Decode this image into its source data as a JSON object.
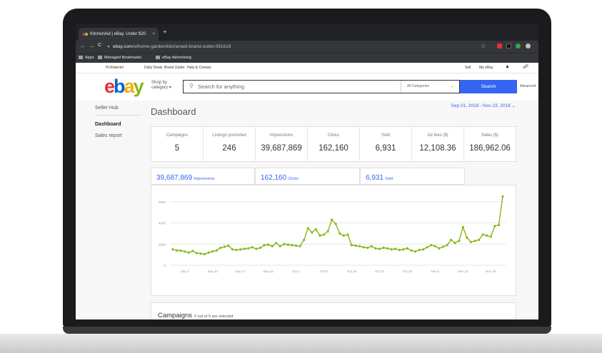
{
  "browser": {
    "tab_title": "KitchenAid | eBay. Under $20",
    "tab_close": "×",
    "new_tab": "+",
    "url_host": "ebay.com",
    "url_path": "/e/home-garden/kitchenaid-brand-outlet-091619",
    "back": "←",
    "forward": "→",
    "reload": "C",
    "star": "☆",
    "bookmarks": [
      "Apps",
      "Managed Bookmarks",
      "eBay Advertising"
    ]
  },
  "ebay": {
    "topnav": {
      "greeting": "Hi Roberto!",
      "links": [
        "Daily Deals",
        "Brand Outlet",
        "Help & Contact"
      ],
      "sell": "Sell",
      "my_ebay": "My eBay"
    },
    "logo_letters": [
      "e",
      "b",
      "a",
      "y"
    ],
    "logo_colors": [
      "#e53238",
      "#0064d2",
      "#f5af02",
      "#86b817"
    ],
    "shop_by": "Shop by category",
    "search_placeholder": "Search for anything",
    "all_categories": "All Categories",
    "search_button": "Search",
    "advanced": "Advanced"
  },
  "sidebar": {
    "title": "Seller Hub",
    "items": [
      "Dashboard",
      "Sales report"
    ]
  },
  "dashboard": {
    "title": "Dashboard",
    "date_range": "Sep 01, 2018 - Nov 23, 2018",
    "stats": [
      {
        "label": "Campaigns",
        "value": "5"
      },
      {
        "label": "Listings promoted",
        "value": "246"
      },
      {
        "label": "Impressions",
        "value": "39,687,869"
      },
      {
        "label": "Clicks",
        "value": "162,160"
      },
      {
        "label": "Sold",
        "value": "6,931"
      },
      {
        "label": "Ad fees ($)",
        "value": "12,108.36"
      },
      {
        "label": "Sales ($)",
        "value": "186,962.06"
      }
    ],
    "metric_tabs": [
      {
        "value": "39,687,869",
        "unit": "Impressions"
      },
      {
        "value": "162,160",
        "unit": "Clicks"
      },
      {
        "value": "6,931",
        "unit": "Sold"
      }
    ],
    "campaigns_title": "Campaigns",
    "campaigns_sub": "0 out of 5 are selected"
  },
  "chart_data": {
    "type": "line",
    "y_ticks": [
      "6000",
      "4000",
      "2000",
      "0"
    ],
    "x_ticks": [
      "Sep 3",
      "Sep 10",
      "Sep 17",
      "Sep 24",
      "Oct 1",
      "Oct 8",
      "Oct 15",
      "Oct 22",
      "Oct 29",
      "Nov 5",
      "Nov 12",
      "Nov 19"
    ],
    "ylim": [
      0,
      7000
    ],
    "line_color": "#86b817",
    "values": [
      1500,
      1400,
      1380,
      1300,
      1200,
      1350,
      1150,
      1100,
      1050,
      1200,
      1300,
      1400,
      1650,
      1750,
      1850,
      1500,
      1450,
      1500,
      1550,
      1600,
      1700,
      1550,
      1650,
      1900,
      1950,
      1800,
      2100,
      1800,
      2000,
      1950,
      1900,
      1850,
      1800,
      2400,
      3500,
      3100,
      3400,
      2800,
      2900,
      3200,
      4300,
      3900,
      3000,
      2800,
      2900,
      1900,
      1850,
      1800,
      1700,
      1650,
      1800,
      1600,
      1550,
      1650,
      1600,
      1500,
      1550,
      1450,
      1500,
      1600,
      1400,
      1300,
      1450,
      1500,
      1700,
      1900,
      1800,
      1600,
      1750,
      1900,
      2400,
      2100,
      2300,
      3600,
      2600,
      2200,
      2300,
      2400,
      2900,
      2800,
      2700,
      3700,
      3800,
      6500
    ]
  }
}
